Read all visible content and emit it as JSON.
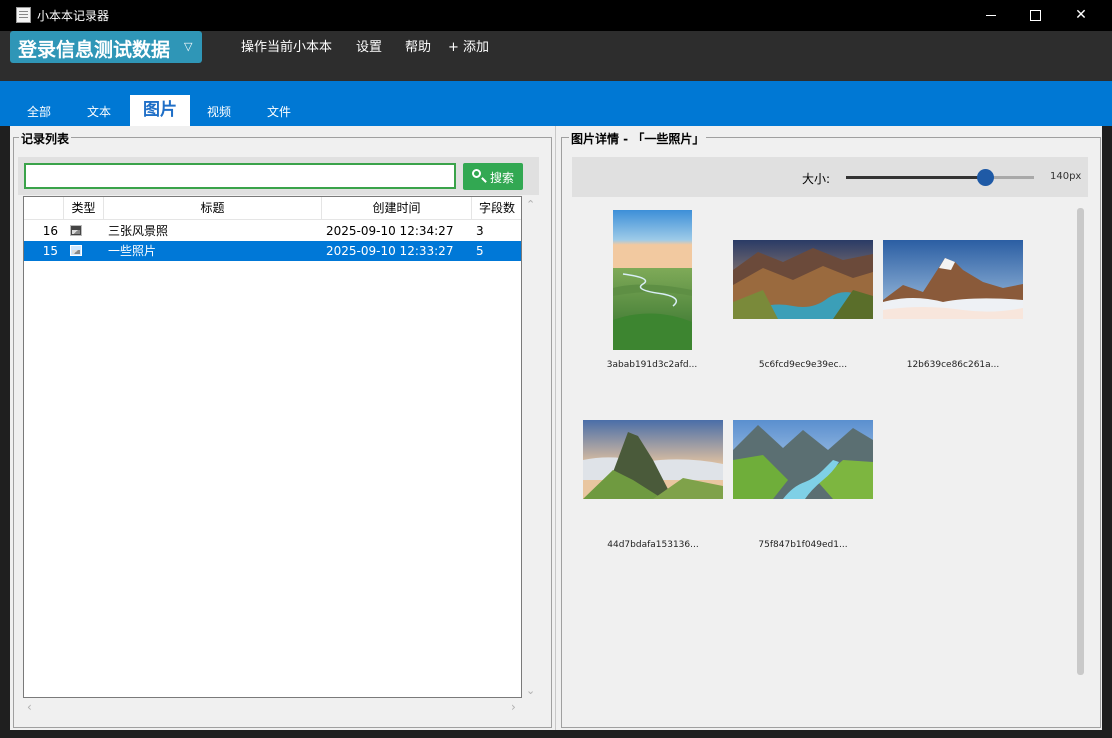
{
  "window": {
    "title": "小本本记录器",
    "minimize_icon": "minimize-icon",
    "maximize_icon": "maximize-icon",
    "close_icon": "close-icon",
    "close_symbol": "✕"
  },
  "menubar": {
    "notebook_name": "登录信息测试数据",
    "notebook_arrow": "▽",
    "items": [
      "操作当前小本本",
      "设置",
      "帮助",
      "+ 添加"
    ]
  },
  "tabs": {
    "items": [
      "全部",
      "文本",
      "图片",
      "视频",
      "文件"
    ],
    "active": "图片"
  },
  "record_list": {
    "title": "记录列表",
    "search": {
      "value": "",
      "placeholder": "",
      "button_label": "搜索"
    },
    "columns": [
      "类型",
      "标题",
      "创建时间",
      "字段数"
    ],
    "rows": [
      {
        "id": "16",
        "type_icon": "image-icon",
        "title": "三张风景照",
        "created": "2025-09-10 12:34:27",
        "fields": "3",
        "selected": false
      },
      {
        "id": "15",
        "type_icon": "image-icon",
        "title": "一些照片",
        "created": "2025-09-10 12:33:27",
        "fields": "5",
        "selected": true
      }
    ],
    "scroll_up": "⌃",
    "scroll_down": "⌄",
    "scroll_left": "‹",
    "scroll_right": "›"
  },
  "image_detail": {
    "title": "图片详情 - 「一些照片」",
    "size_label": "大小:",
    "size_value": "140px",
    "size_fraction": 0.74,
    "images": [
      {
        "name": "3abab191d3c2afd...",
        "scene": "green-meadow-river"
      },
      {
        "name": "5c6fcd9ec9e39ec...",
        "scene": "canyon-river-sunset"
      },
      {
        "name": "12b639ce86c261a...",
        "scene": "snow-peak-clouds"
      },
      {
        "name": "44d7bdafa153136...",
        "scene": "mountain-ridge-mist"
      },
      {
        "name": "75f847b1f049ed1...",
        "scene": "green-valley-stream"
      }
    ]
  }
}
